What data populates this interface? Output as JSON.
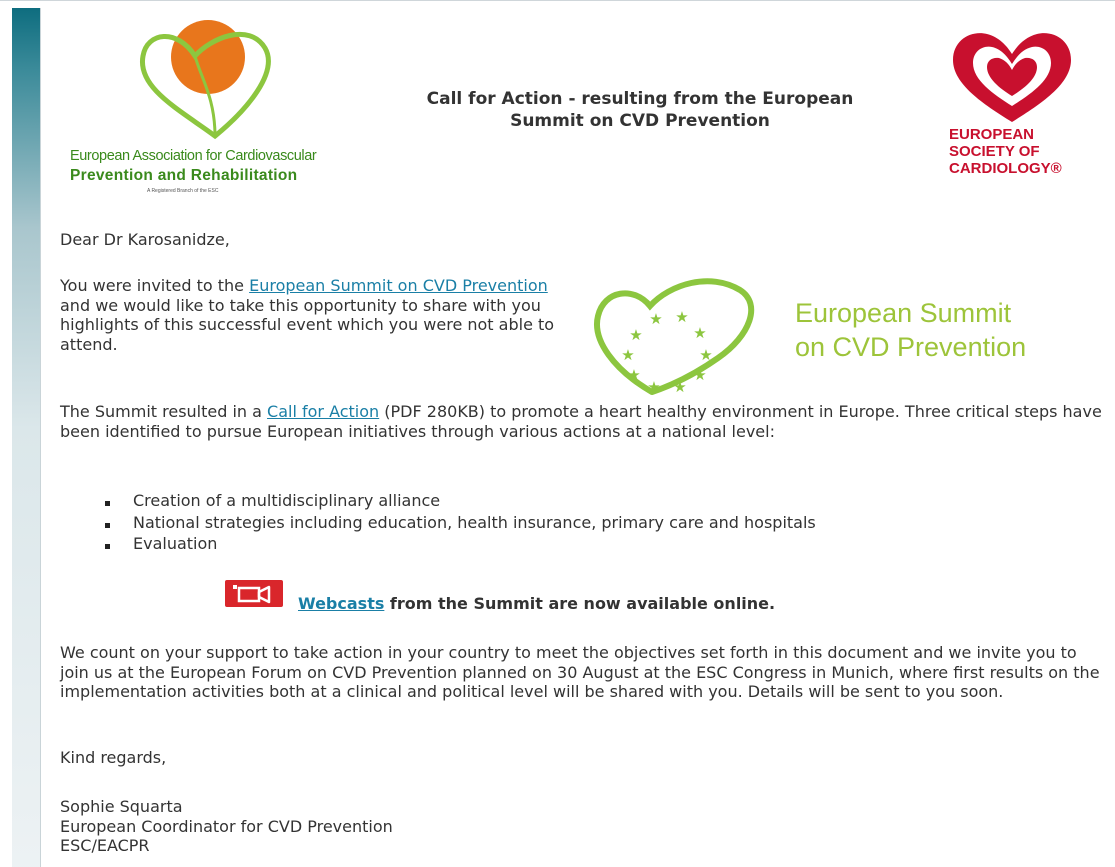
{
  "header": {
    "title_line1": "Call for Action - resulting from the European",
    "title_line2": "Summit on CVD Prevention"
  },
  "logos": {
    "eacpr": {
      "line1": "European Association for Cardiovascular",
      "line2": "Prevention and Rehabilitation",
      "line3": "A Registered Branch of the ESC",
      "color": "#3a8a1c",
      "accent": "#e8761c"
    },
    "esc": {
      "line1": "EUROPEAN",
      "line2": "SOCIETY OF",
      "line3": "CARDIOLOGY®",
      "color": "#c8102e"
    },
    "summit": {
      "line1": "European Summit",
      "line2": "on CVD Prevention",
      "color": "#9dc43a"
    }
  },
  "email": {
    "greeting": "Dear Dr Karosanidze,",
    "intro": {
      "before": "You were invited to the ",
      "link": "European Summit on CVD Prevention",
      "after": " and we would like to take this opportunity to share with you highlights of this successful event which you were not able to attend."
    },
    "result": {
      "before": "The Summit resulted in a ",
      "link": "Call for Action",
      "after": " (PDF 280KB) to promote a heart healthy environment in Europe. Three critical steps have been identified to pursue European initiatives through various actions at a national level:"
    },
    "steps": [
      "Creation of a multidisciplinary alliance",
      "National strategies including education, health insurance, primary care and hospitals",
      "Evaluation"
    ],
    "webcast": {
      "icon": "video-camera-icon",
      "link": "Webcasts",
      "after": " from the Summit are now available online."
    },
    "support": "We count on your support to take action in your country to meet the objectives set forth in this document and we invite you to join us at the European Forum on CVD Prevention planned on 30 August at the ESC Congress in Munich, where first results on the implementation activities both at a clinical and political level will be shared with you. Details will be sent to you soon.",
    "regards": "Kind regards,",
    "signature": {
      "name": "Sophie Squarta",
      "role": "European Coordinator for CVD Prevention",
      "org": "ESC/EACPR"
    }
  },
  "colors": {
    "link": "#1a7fa6",
    "text": "#333333",
    "sidebar": "#0e6d7f"
  }
}
